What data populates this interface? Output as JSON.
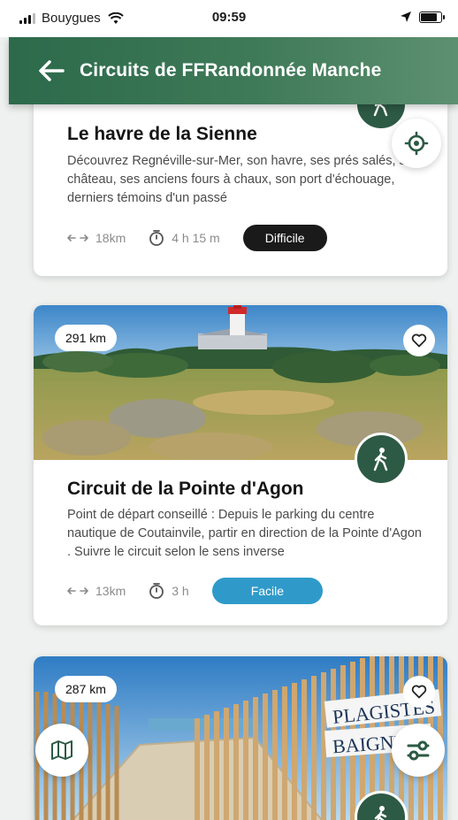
{
  "status": {
    "carrier": "Bouygues",
    "time": "09:59"
  },
  "header": {
    "title": "Circuits de FFRandonnée Manche"
  },
  "circuits": [
    {
      "title": "Le havre de la Sienne",
      "description": "Découvrez Regnéville-sur-Mer, son havre, ses prés salés, son château, ses anciens fours à chaux, son port d'échouage, derniers témoins d'un passé",
      "distance": "18km",
      "duration": "4 h 15 m",
      "difficulty": "Difficile"
    },
    {
      "badge": "291 km",
      "title": "Circuit de la Pointe d'Agon",
      "description": "Point de départ conseillé : Depuis le parking du centre nautique de Coutainvile, partir en direction de la Pointe d'Agon . Suivre le circuit selon le sens inverse",
      "distance": "13km",
      "duration": "3 h",
      "difficulty": "Facile"
    },
    {
      "badge": "287 km",
      "sign_line1": "PLAGISTES",
      "sign_line2": "BAIGNEU"
    }
  ],
  "colors": {
    "primary": "#2c6a4b",
    "difficult": "#1a1a1a",
    "easy": "#2f9ac9"
  },
  "icons": [
    "back-arrow-icon",
    "locate-icon",
    "heart-icon",
    "hiker-icon",
    "map-icon",
    "filter-icon",
    "distance-icon",
    "timer-icon"
  ]
}
